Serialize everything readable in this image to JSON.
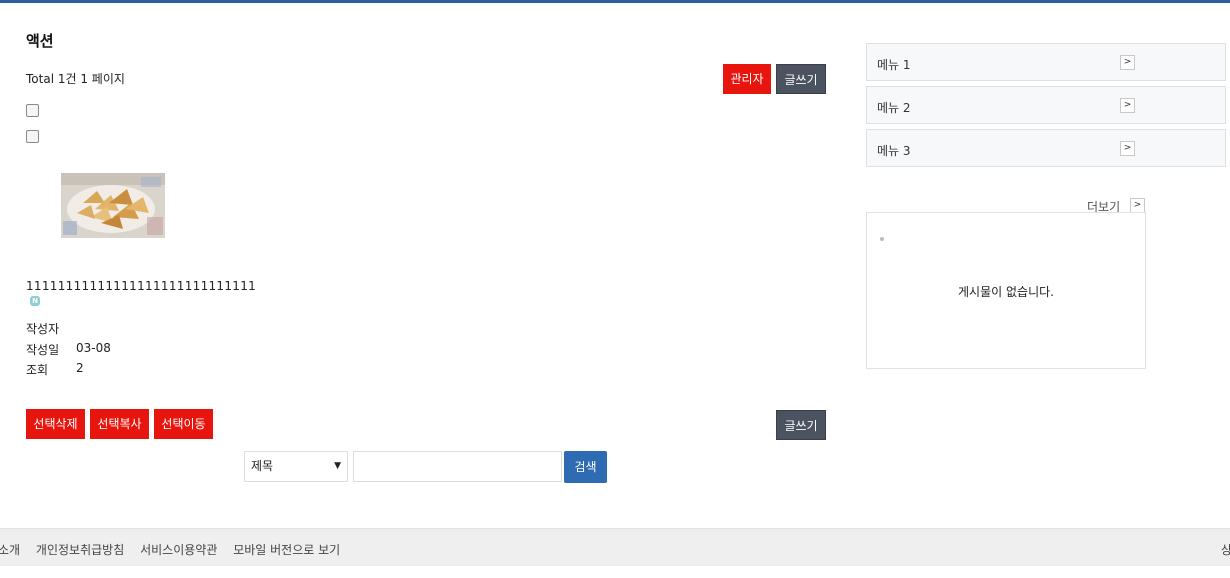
{
  "board": {
    "title": "액션",
    "total": "Total 1건 1 페이지",
    "admin_label": "관리자",
    "write_label": "글쓰기"
  },
  "post": {
    "subject": "11111111111111111111111111111",
    "new_badge": "N",
    "author_label": "작성자",
    "date_label": "작성일",
    "date_value": "03-08",
    "views_label": "조회",
    "views_value": "2"
  },
  "actions": {
    "delete_selected": "선택삭제",
    "copy_selected": "선택복사",
    "move_selected": "선택이동",
    "write_label": "글쓰기"
  },
  "search": {
    "field_selected": "제목",
    "query_value": "",
    "submit_label": "검색"
  },
  "sidebar": {
    "menus": [
      {
        "label": "메뉴 1"
      },
      {
        "label": "메뉴 2"
      },
      {
        "label": "메뉴 3"
      }
    ],
    "more_label": "더보기",
    "empty_message": "게시물이 없습니다."
  },
  "footer": {
    "links": [
      "소개",
      "개인정보취급방침",
      "서비스이용약관",
      "모바일 버전으로 보기"
    ],
    "right_text": "상"
  },
  "colors": {
    "accent_bar": "#2c5f9e",
    "red_button": "#e8150e",
    "dark_button": "#4c5360",
    "search_button": "#2f6bb2"
  }
}
